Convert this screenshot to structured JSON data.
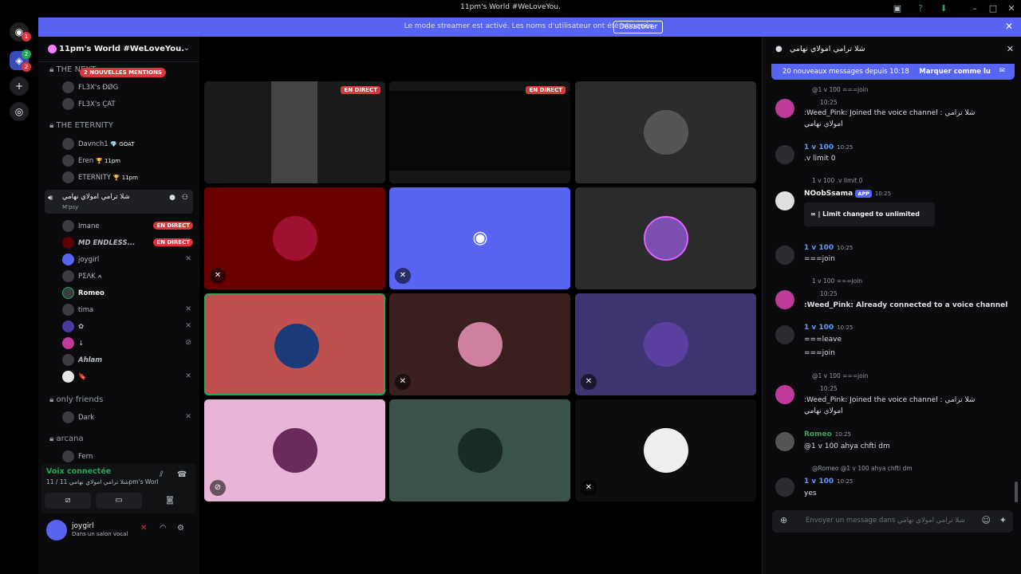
{
  "window": {
    "title": "11pm's World #WeLoveYou."
  },
  "banner": {
    "message": "Le mode streamer est activé. Les noms d'utilisateur ont été tronqués.",
    "button": "Désactiver"
  },
  "rail": {
    "badge1": "1",
    "badge2": "2",
    "badge3": "2"
  },
  "server": {
    "name": "11pm's World #WeLoveYou."
  },
  "sidebar": {
    "mentions_pill": "2 NOUVELLES MENTIONS",
    "cat1": "THE NEXT",
    "cat1_users": [
      "FL3X's ÐØG",
      "FL3X's ÇAT"
    ],
    "cat2": "THE ETERNITY",
    "cat2_users": [
      {
        "name": "Davnch1",
        "tag": "💎 GOAT"
      },
      {
        "name": "Eren",
        "tag": "🏆 11pm"
      },
      {
        "name": "ETERNITY",
        "tag": "🏆 11pm"
      }
    ],
    "active_channel": "شلا ترامي امولاي نهامي",
    "active_sub": "M'psy",
    "voice_users": [
      "Imane",
      "MD ENDLESS...",
      "joygirl",
      "PΣΛK ⍲",
      "Romeo",
      "tima",
      "✿",
      "↓",
      "Ahlam",
      "🔖"
    ],
    "live_label": "EN DIRECT",
    "cat3": "only friends",
    "cat3_users": [
      "Dark"
    ],
    "cat4": "arcana",
    "cat4_users": [
      "Fern"
    ]
  },
  "voice": {
    "status": "Voix connectée",
    "channel": "11 / شلا ترامي امولاي نهامي 11pm's World #WeLoveY..."
  },
  "user": {
    "name": "joygirl",
    "status": "Dans un salon vocal"
  },
  "grid": {
    "live_label": "EN DIRECT"
  },
  "chat": {
    "title": "شلا ترامي امولاي نهامي",
    "new_bar": "20 nouveaux messages depuis 10:18",
    "mark_read": "Marquer comme lu",
    "messages": [
      {
        "ref": "@1 v 100 ===join",
        "time": "10:25",
        "text": ":Weed_Pink: Joined the voice channel : شلا ترامي",
        "text2": "امولاي نهامي"
      },
      {
        "author": "1 v 100",
        "time": "10:25",
        "text": ".v limit 0"
      },
      {
        "ref": "1 v 100 .v limit 0",
        "author": "NOobSsama",
        "app": "APP",
        "time": "10:25",
        "text": "∞ | Limit changed to unlimited"
      },
      {
        "author": "1 v 100",
        "time": "10:25",
        "text": "===join"
      },
      {
        "ref": "1 v 100 ===join",
        "time": "10:25",
        "text": ":Weed_Pink: Already connected to a voice channel"
      },
      {
        "author": "1 v 100",
        "time": "10:25",
        "text": "===leave",
        "text2": "===join"
      },
      {
        "ref": "@1 v 100 ===join",
        "time": "10:25",
        "text": ":Weed_Pink: Joined the voice channel : شلا ترامي",
        "text2": "امولاي نهامي"
      },
      {
        "author": "Romeo",
        "time": "10:25",
        "text": "@1 v 100 ahya chfti dm"
      },
      {
        "ref": "@Romeo @1 v 100 ahya chfti dm",
        "author": "1 v 100",
        "time": "10:25",
        "text": "yes"
      }
    ],
    "composer_placeholder": "Envoyer un message dans شلا ترامي امولاي نهامي"
  }
}
